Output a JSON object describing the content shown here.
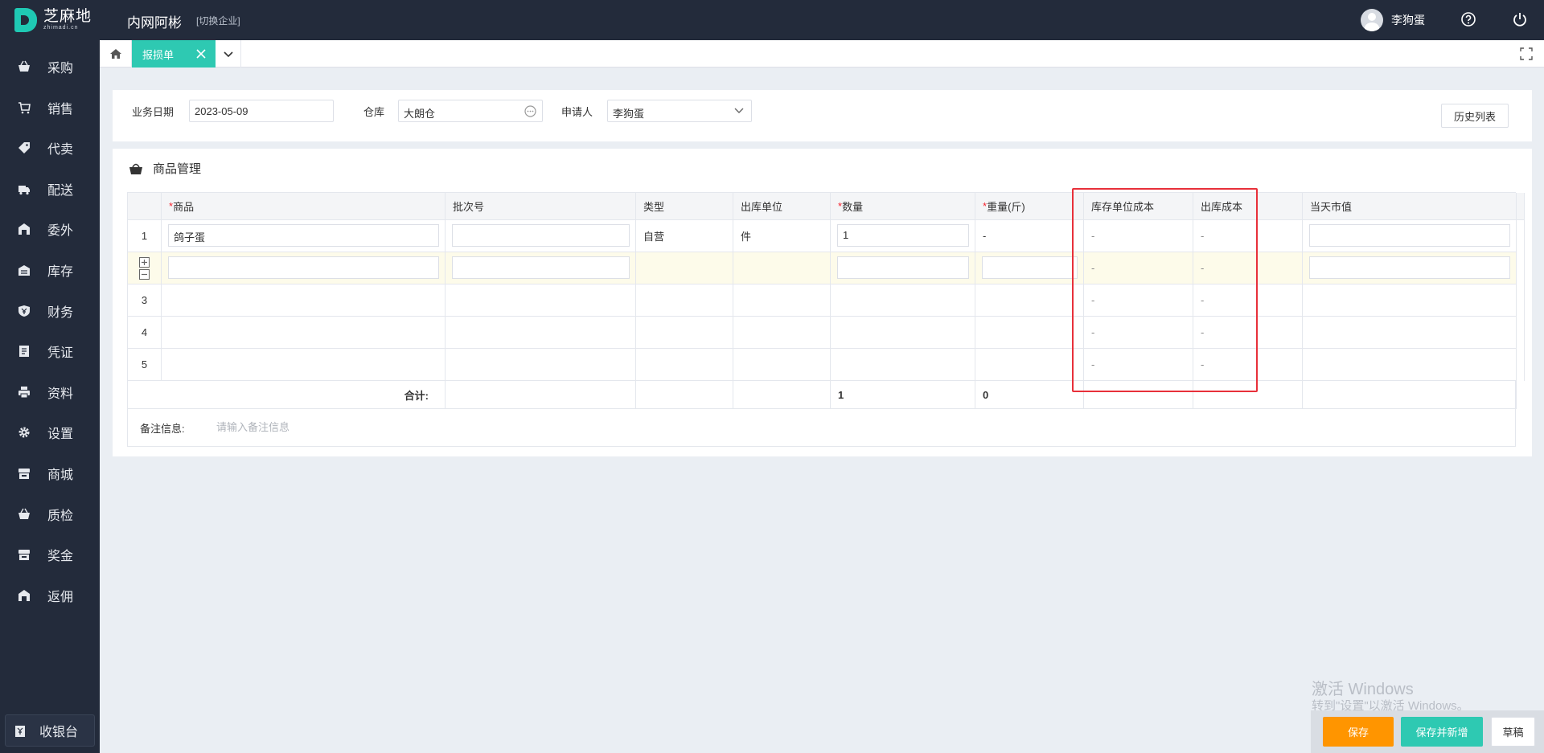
{
  "header": {
    "logo_text": "芝麻地",
    "logo_sub": "zhimadi.cn",
    "company": "内网阿彬",
    "switch_label": "[切换企业]",
    "user_name": "李狗蛋"
  },
  "sidebar": {
    "items": [
      {
        "label": "采购",
        "icon": "basket-icon"
      },
      {
        "label": "销售",
        "icon": "cart-icon"
      },
      {
        "label": "代卖",
        "icon": "tag-icon"
      },
      {
        "label": "配送",
        "icon": "truck-icon"
      },
      {
        "label": "委外",
        "icon": "outsource-icon"
      },
      {
        "label": "库存",
        "icon": "warehouse-icon"
      },
      {
        "label": "财务",
        "icon": "finance-shield-icon"
      },
      {
        "label": "凭证",
        "icon": "voucher-icon"
      },
      {
        "label": "资料",
        "icon": "printer-icon"
      },
      {
        "label": "设置",
        "icon": "gear-icon"
      },
      {
        "label": "商城",
        "icon": "store-icon"
      },
      {
        "label": "质检",
        "icon": "basket-icon"
      },
      {
        "label": "奖金",
        "icon": "store-icon"
      },
      {
        "label": "返佣",
        "icon": "outsource-icon"
      }
    ],
    "cashier_label": "收银台"
  },
  "tabs": {
    "active_label": "报损单"
  },
  "form": {
    "date_label": "业务日期",
    "date_value": "2023-05-09",
    "warehouse_label": "仓库",
    "warehouse_value": "大朗仓",
    "applicant_label": "申请人",
    "applicant_value": "李狗蛋",
    "history_button": "历史列表"
  },
  "goods": {
    "title": "商品管理",
    "columns": [
      "商品",
      "批次号",
      "类型",
      "出库单位",
      "数量",
      "重量(斤)",
      "库存单位成本",
      "出库成本",
      "当天市值"
    ],
    "rows": [
      {
        "no": "1",
        "product": "鸽子蛋",
        "batch": "",
        "type": "自营",
        "unit": "件",
        "qty": "1",
        "weight": "-",
        "stock_cost": "-",
        "out_cost": "-",
        "market": ""
      },
      {
        "no": "",
        "product": "",
        "batch": "",
        "type": "",
        "unit": "",
        "qty": "",
        "weight": "",
        "stock_cost": "-",
        "out_cost": "-",
        "market": ""
      },
      {
        "no": "3",
        "product": "",
        "batch": "",
        "type": "",
        "unit": "",
        "qty": "",
        "weight": "",
        "stock_cost": "-",
        "out_cost": "-",
        "market": ""
      },
      {
        "no": "4",
        "product": "",
        "batch": "",
        "type": "",
        "unit": "",
        "qty": "",
        "weight": "",
        "stock_cost": "-",
        "out_cost": "-",
        "market": ""
      },
      {
        "no": "5",
        "product": "",
        "batch": "",
        "type": "",
        "unit": "",
        "qty": "",
        "weight": "",
        "stock_cost": "-",
        "out_cost": "-",
        "market": ""
      }
    ],
    "total_label": "合计:",
    "total_qty": "1",
    "total_weight": "0",
    "remark_label": "备注信息:",
    "remark_placeholder": "请输入备注信息"
  },
  "actions": {
    "save": "保存",
    "save_new": "保存并新增",
    "draft": "草稿"
  },
  "watermark": {
    "line1": "激活 Windows",
    "line2": "转到\"设置\"以激活 Windows。"
  },
  "colors": {
    "sidebar_bg": "#232b3b",
    "accent_teal": "#2ec9b2",
    "save_orange": "#ff9500",
    "highlight_red": "#e8303a"
  }
}
